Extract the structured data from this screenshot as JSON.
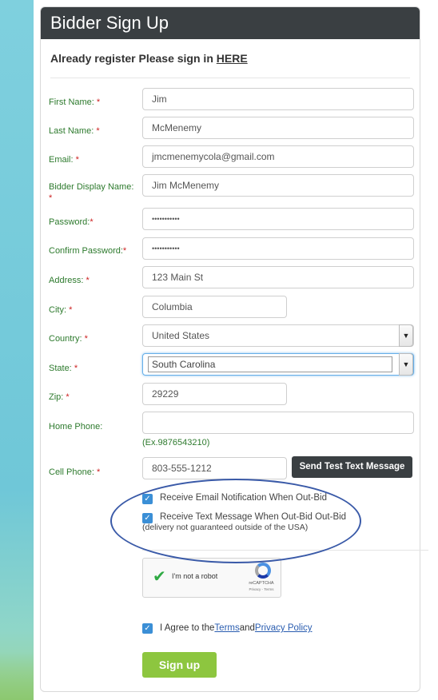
{
  "header": {
    "title": "Bidder Sign Up"
  },
  "signin": {
    "prefix": "Already register Please sign in ",
    "link": "HERE"
  },
  "fields": {
    "first_name": {
      "label": "First Name:",
      "required": "*",
      "value": "Jim"
    },
    "last_name": {
      "label": "Last Name:",
      "required": "*",
      "value": "McMenemy"
    },
    "email": {
      "label": "Email:",
      "required": "*",
      "value": "jmcmenemycola@gmail.com"
    },
    "display_name": {
      "label": "Bidder Display Name:",
      "required": "*",
      "value": "Jim McMenemy"
    },
    "password": {
      "label": "Password:",
      "required": "*",
      "value": "•••••••••••"
    },
    "confirm_password": {
      "label": "Confirm Password:",
      "required": "*",
      "value": "•••••••••••"
    },
    "address": {
      "label": "Address:",
      "required": "*",
      "value": "123 Main St"
    },
    "city": {
      "label": "City:",
      "required": "*",
      "value": "Columbia"
    },
    "country": {
      "label": "Country:",
      "required": "*",
      "value": "United States"
    },
    "state": {
      "label": "State:",
      "required": "*",
      "value": "South Carolina"
    },
    "zip": {
      "label": "Zip:",
      "required": "*",
      "value": "29229"
    },
    "home_phone": {
      "label": "Home Phone:",
      "value": "",
      "hint": "(Ex.9876543210)"
    },
    "cell_phone": {
      "label": "Cell Phone:",
      "required": "*",
      "value": "803-555-1212"
    }
  },
  "buttons": {
    "send_test": "Send Test Text Message",
    "signup": "Sign up"
  },
  "options": {
    "email_notify": "Receive Email Notification When Out-Bid",
    "text_notify": "Receive Text Message When Out-Bid Out-Bid",
    "text_note": "(delivery not guaranteed outside of the USA)"
  },
  "recaptcha": {
    "label": "I'm not a robot",
    "brand": "reCAPTCHA",
    "links": "Privacy - Terms"
  },
  "agree": {
    "prefix": "I Agree to the ",
    "terms": "Terms",
    "and": " and ",
    "privacy": "Privacy Policy"
  },
  "colors": {
    "label_green": "#2d7a2d",
    "header_dark": "#3a3f42",
    "signup_green": "#8dc63f",
    "checkbox_blue": "#3b8fd6",
    "annotation_ellipse": "#3a5aa8"
  }
}
